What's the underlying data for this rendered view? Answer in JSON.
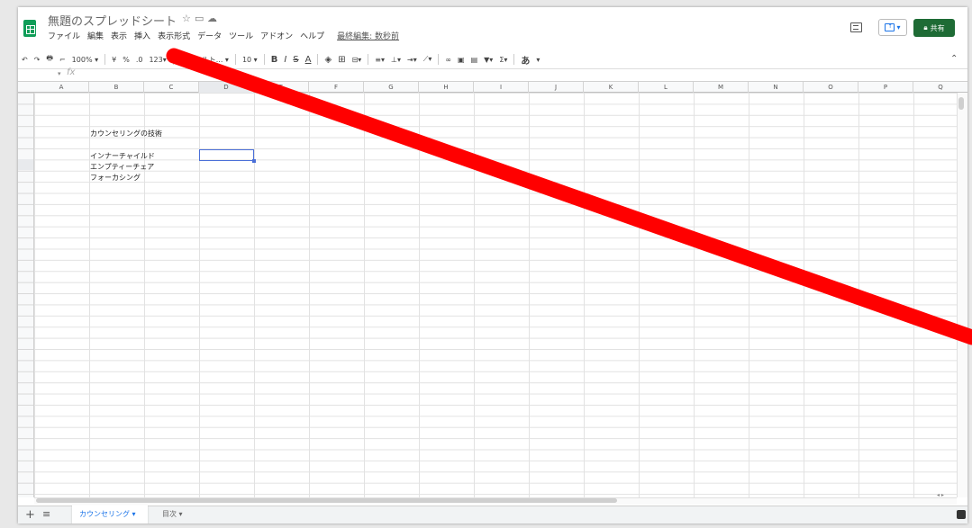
{
  "doc": {
    "title": "無題のスプレッドシート"
  },
  "menu": [
    "ファイル",
    "編集",
    "表示",
    "挿入",
    "表示形式",
    "データ",
    "ツール",
    "アドオン",
    "ヘルプ"
  ],
  "last_edit": "最終編集: 数秒前",
  "share_label": "共有",
  "toolbar": {
    "zoom": "100%",
    "currency": "¥",
    "percent": "%",
    "number_format": "123",
    "font": "デフォルト...",
    "font_size": "10",
    "bold": "B",
    "italic": "I",
    "strike": "S",
    "text_color": "A",
    "input_tool": "あ"
  },
  "formula_bar": {
    "fx": "fx"
  },
  "columns": [
    "A",
    "B",
    "C",
    "D",
    "E",
    "F",
    "G",
    "H",
    "I",
    "J",
    "K",
    "L",
    "M",
    "N",
    "O",
    "P",
    "Q"
  ],
  "selected_column": "D",
  "cells": {
    "b5": "カウンセリングの技術",
    "b7": "インナーチャイルド",
    "b8": "エンプティーチェア",
    "b9": "フォーカシング"
  },
  "sheets": {
    "active": "カウンセリング",
    "other": "目次"
  },
  "colors": {
    "share": "#1e6b35",
    "selection": "#4a6fd8",
    "annotation_stroke": "#ff0000"
  }
}
